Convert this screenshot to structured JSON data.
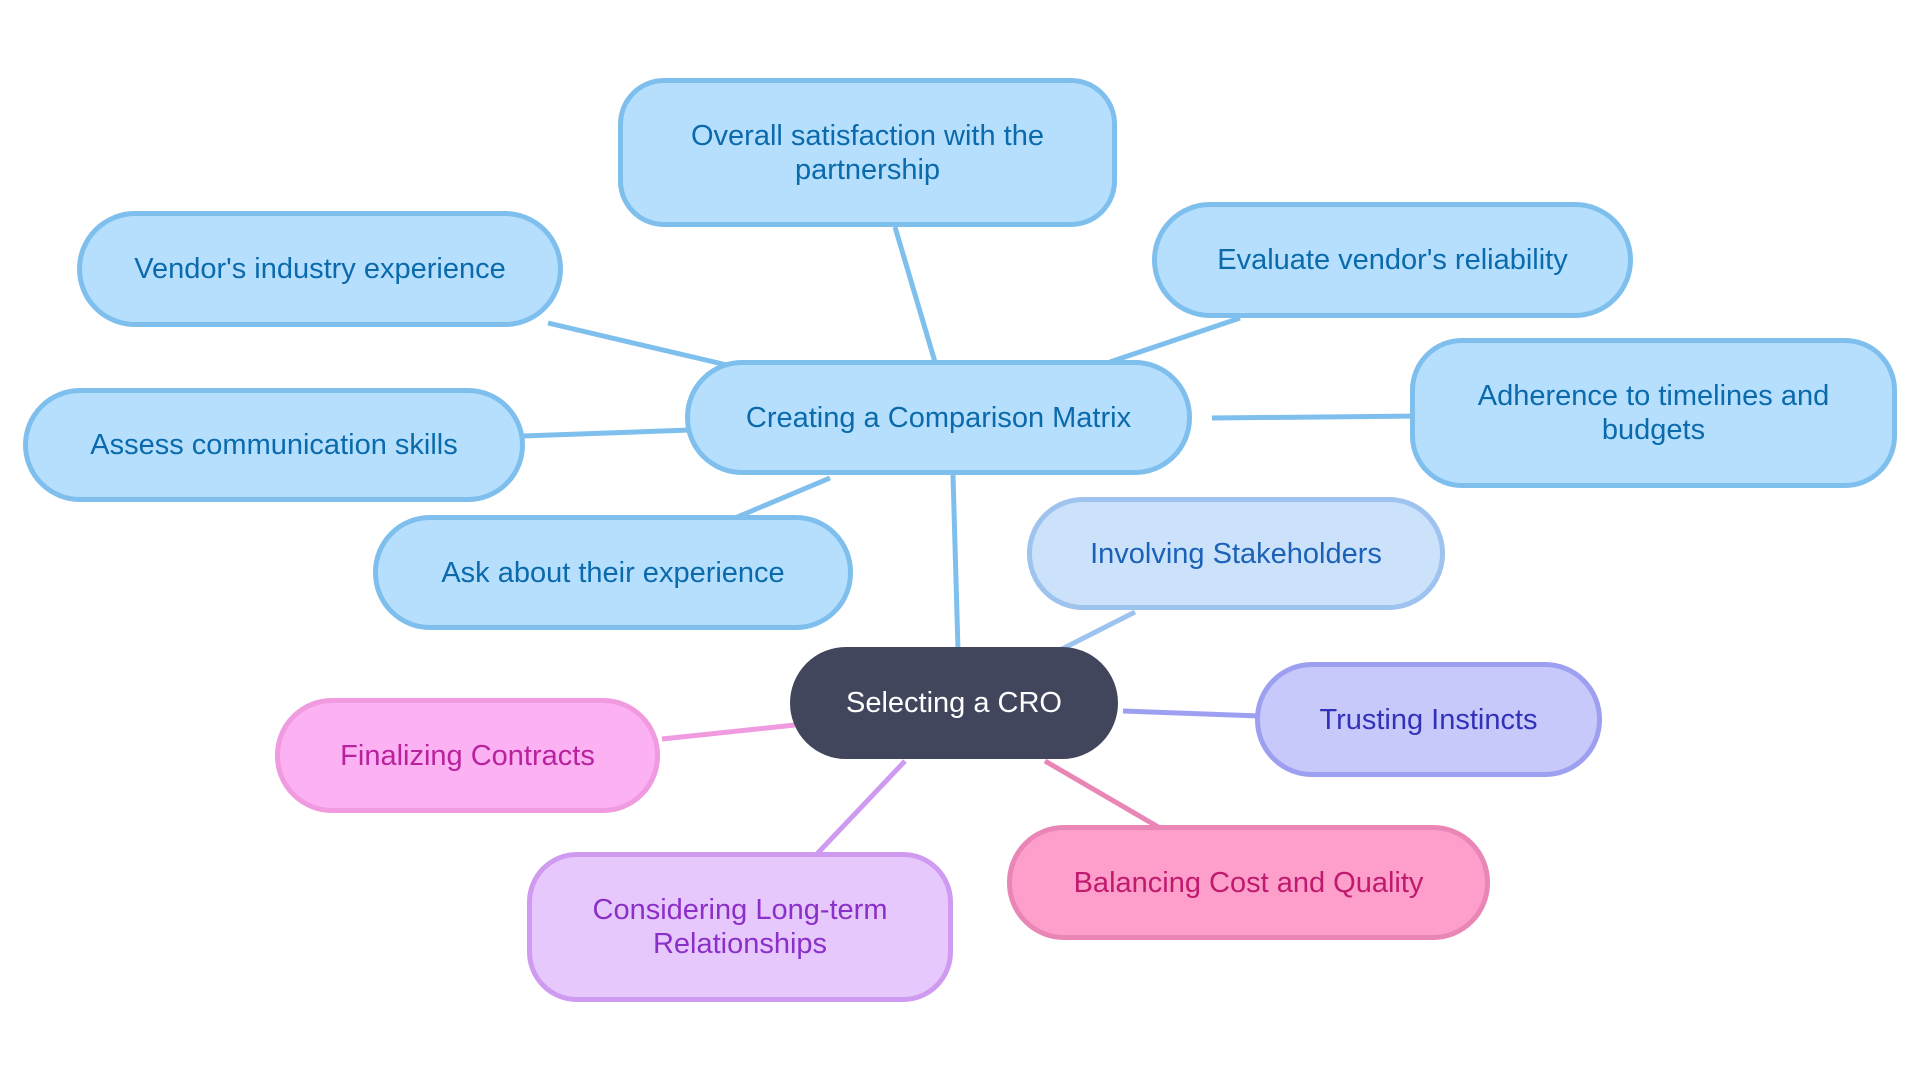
{
  "diagram": {
    "type": "mindmap",
    "root": {
      "id": "root",
      "label": "Selecting a CRO",
      "theme": "root"
    },
    "nodes": [
      {
        "id": "matrix",
        "label": "Creating a Comparison Matrix",
        "parent": "root",
        "theme": "t-blue"
      },
      {
        "id": "overall",
        "label": "Overall satisfaction with the partnership",
        "parent": "matrix",
        "theme": "t-blue"
      },
      {
        "id": "vendor",
        "label": "Vendor's industry experience",
        "parent": "matrix",
        "theme": "t-blue"
      },
      {
        "id": "evaluate",
        "label": "Evaluate vendor's reliability",
        "parent": "matrix",
        "theme": "t-blue"
      },
      {
        "id": "adherence",
        "label": "Adherence to timelines and budgets",
        "parent": "matrix",
        "theme": "t-blue"
      },
      {
        "id": "assess",
        "label": "Assess communication skills",
        "parent": "matrix",
        "theme": "t-blue"
      },
      {
        "id": "ask",
        "label": "Ask about their experience",
        "parent": "matrix",
        "theme": "t-blue"
      },
      {
        "id": "involving",
        "label": "Involving Stakeholders",
        "parent": "root",
        "theme": "t-lightblue"
      },
      {
        "id": "trusting",
        "label": "Trusting Instincts",
        "parent": "root",
        "theme": "t-indigo"
      },
      {
        "id": "balancing",
        "label": "Balancing Cost and Quality",
        "parent": "root",
        "theme": "t-pink"
      },
      {
        "id": "considering",
        "label": "Considering Long-term Relationships",
        "parent": "root",
        "theme": "t-purple"
      },
      {
        "id": "finalizing",
        "label": "Finalizing Contracts",
        "parent": "root",
        "theme": "t-magenta"
      }
    ],
    "colors": {
      "root_fill": "#42465d",
      "blue_edge": "#7fbfed",
      "lightblue_edge": "#9ec3ee",
      "indigo_edge": "#9d9ff0",
      "pink_edge": "#ea86b6",
      "purple_edge": "#cf9bf0",
      "magenta_edge": "#f09ae0"
    }
  }
}
